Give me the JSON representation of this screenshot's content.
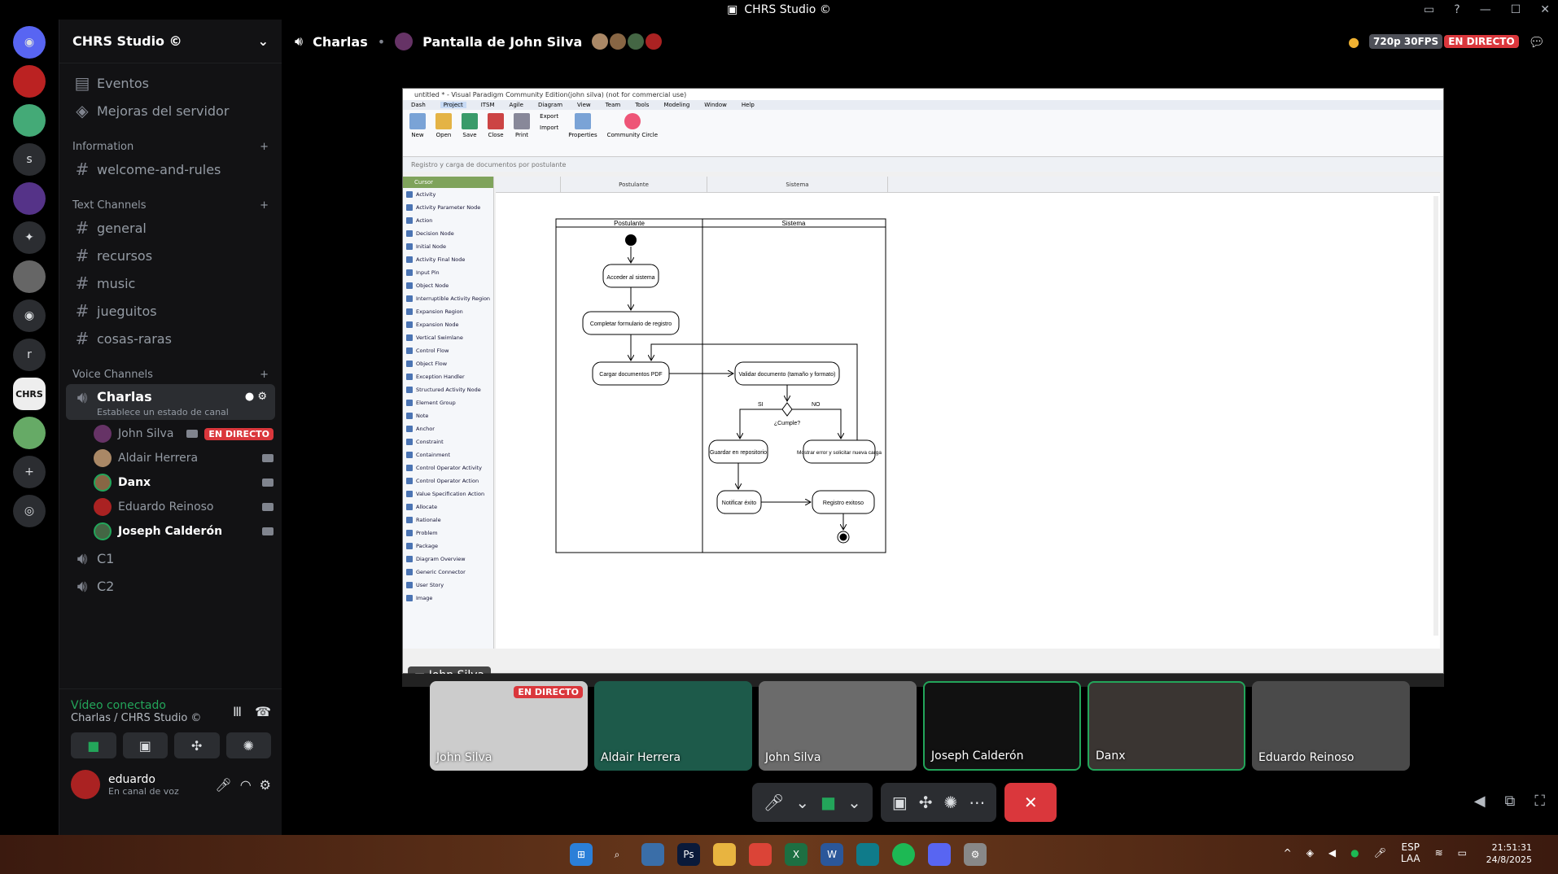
{
  "titlebar": {
    "title": "CHRS Studio ©"
  },
  "sidebar": {
    "server_name": "CHRS Studio ©",
    "top_items": [
      {
        "label": "Eventos"
      },
      {
        "label": "Mejoras del servidor"
      }
    ],
    "categories": {
      "information": {
        "label": "Information",
        "channels": [
          {
            "label": "welcome-and-rules"
          }
        ]
      },
      "text": {
        "label": "Text Channels",
        "channels": [
          {
            "label": "general"
          },
          {
            "label": "recursos"
          },
          {
            "label": "music"
          },
          {
            "label": "jueguitos"
          },
          {
            "label": "cosas-raras"
          }
        ]
      },
      "voice": {
        "label": "Voice Channels",
        "active_channel": "Charlas",
        "status_placeholder": "Establece un estado de canal",
        "users": [
          {
            "name": "John Silva",
            "live": "EN DIRECTO"
          },
          {
            "name": "Aldair Herrera"
          },
          {
            "name": "Danx"
          },
          {
            "name": "Eduardo Reinoso"
          },
          {
            "name": "Joseph Calderón"
          }
        ],
        "other_channels": [
          {
            "label": "C1"
          },
          {
            "label": "C2"
          }
        ]
      }
    },
    "voice_status": {
      "label": "Vídeo conectado",
      "location": "Charlas / CHRS Studio ©"
    },
    "user": {
      "name": "eduardo",
      "status": "En canal de voz"
    }
  },
  "stage": {
    "channel": "Charlas",
    "stream_title": "Pantalla de John Silva",
    "quality": "720p 30FPS",
    "live": "EN DIRECTO",
    "streamer_label": "John Silva"
  },
  "vp": {
    "title": "untitled * - Visual Paradigm Community Edition(john silva) (not for commercial use)",
    "menu": [
      "Dash",
      "Project",
      "ITSM",
      "Agile",
      "Diagram",
      "View",
      "Team",
      "Tools",
      "Modeling",
      "Window",
      "Help"
    ],
    "ribbon": [
      "New",
      "Open",
      "Save",
      "Close",
      "Print",
      "Export",
      "Import",
      "Properties",
      "Community Circle"
    ],
    "breadcrumb": "Registro y carga de documentos por postulante",
    "palette_head": "Cursor",
    "palette": [
      "Activity",
      "Activity Parameter Node",
      "Action",
      "Decision Node",
      "Initial Node",
      "Activity Final Node",
      "Input Pin",
      "Object Node",
      "Interruptible Activity Region",
      "Expansion Region",
      "Expansion Node",
      "Vertical Swimlane",
      "Control Flow",
      "Object Flow",
      "Exception Handler",
      "Structured Activity Node",
      "Element Group",
      "Note",
      "Anchor",
      "Constraint",
      "Containment",
      "Control Operator Activity",
      "Control Operator Action",
      "Value Specification Action",
      "Allocate",
      "Rationale",
      "Problem",
      "Package",
      "Diagram Overview",
      "Generic Connector",
      "User Story",
      "Image"
    ],
    "col_headers": [
      "Postulante",
      "Sistema"
    ],
    "diagram": {
      "lane1": "Postulante",
      "lane2": "Sistema",
      "n1": "Acceder al sistema",
      "n2": "Completar formulario de registro",
      "n3": "Cargar documentos PDF",
      "n4": "Validar documento (tamaño y formato)",
      "d1": "¿Cumple?",
      "si": "SI",
      "no": "NO",
      "n5": "Guardar en repositorio",
      "n6": "Mostrar error y solicitar nueva carga",
      "n7": "Notificar éxito",
      "n8": "Registro exitoso"
    }
  },
  "tiles": [
    {
      "name": "John Silva",
      "badge": "EN DIRECTO"
    },
    {
      "name": "Aldair Herrera"
    },
    {
      "name": "John Silva"
    },
    {
      "name": "Joseph Calderón"
    },
    {
      "name": "Danx"
    },
    {
      "name": "Eduardo Reinoso"
    }
  ],
  "taskbar": {
    "lang1": "ESP",
    "lang2": "LAA",
    "time": "21:51:31",
    "date": "24/8/2025"
  },
  "colors": {
    "live": "#da373c",
    "connected": "#23a55a",
    "discord": "#5865f2"
  }
}
